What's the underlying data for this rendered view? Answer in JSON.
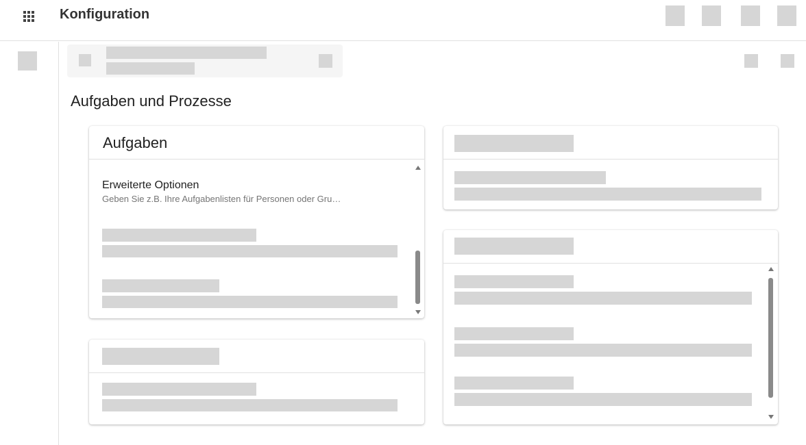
{
  "header": {
    "apps_icon": "apps-grid-icon",
    "title": "Konfiguration"
  },
  "page": {
    "title": "Aufgaben und Prozesse"
  },
  "cards": {
    "tasks": {
      "title": "Aufgaben",
      "items": [
        {
          "title": "Erweiterte Optionen",
          "description": "Geben Sie z.B. Ihre Aufgabenlisten für Personen oder Gru…"
        }
      ]
    }
  }
}
